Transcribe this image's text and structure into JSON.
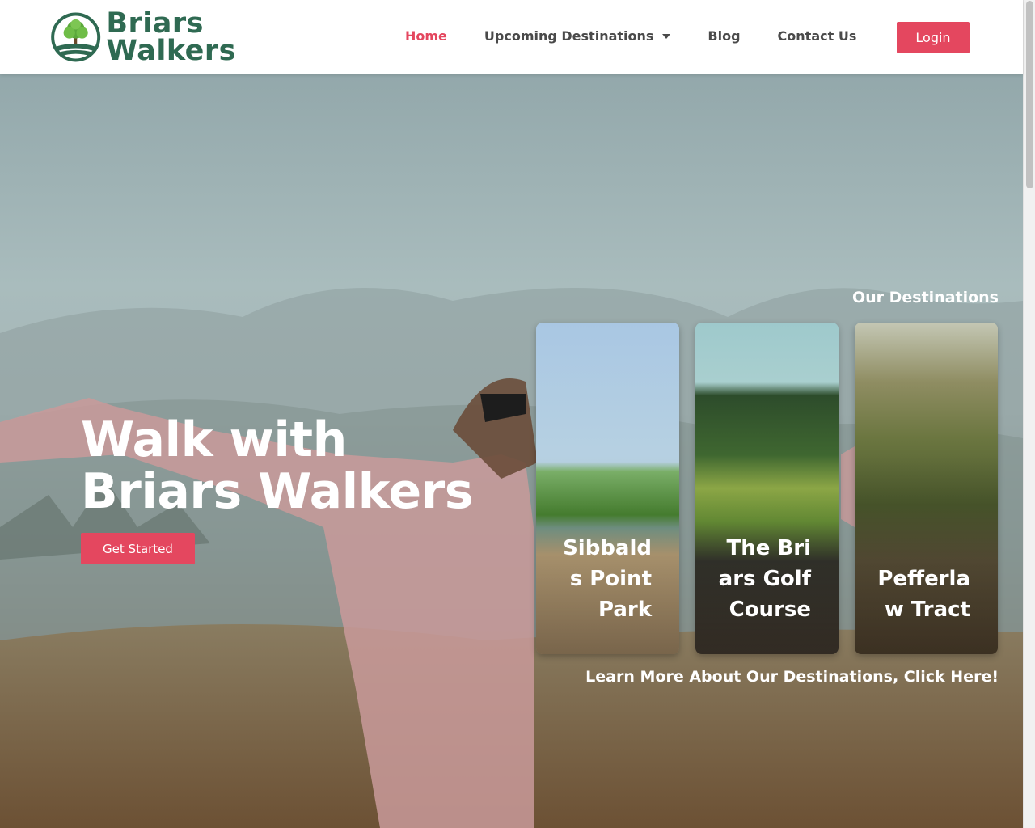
{
  "brand": {
    "line1": "Briars",
    "line2": "Walkers",
    "color": "#2f6a52"
  },
  "nav": {
    "home": "Home",
    "upcoming": "Upcoming Destinations",
    "blog": "Blog",
    "contact": "Contact Us",
    "login": "Login"
  },
  "hero": {
    "line1": "Walk with",
    "line2": "Briars Walkers",
    "cta": "Get Started"
  },
  "destinations": {
    "title": "Our Destinations",
    "cards": [
      {
        "name": "Sibbalds Point Park"
      },
      {
        "name": "The Briars Golf Course"
      },
      {
        "name": "Pefferlaw Tract"
      }
    ],
    "learn_more": "Learn More About Our Destinations, Click Here!"
  },
  "colors": {
    "accent": "#e4475f",
    "nav_text": "#4a4a4a"
  },
  "icons": {
    "dropdown": "caret-down-icon",
    "logo": "tree-logo-icon"
  }
}
